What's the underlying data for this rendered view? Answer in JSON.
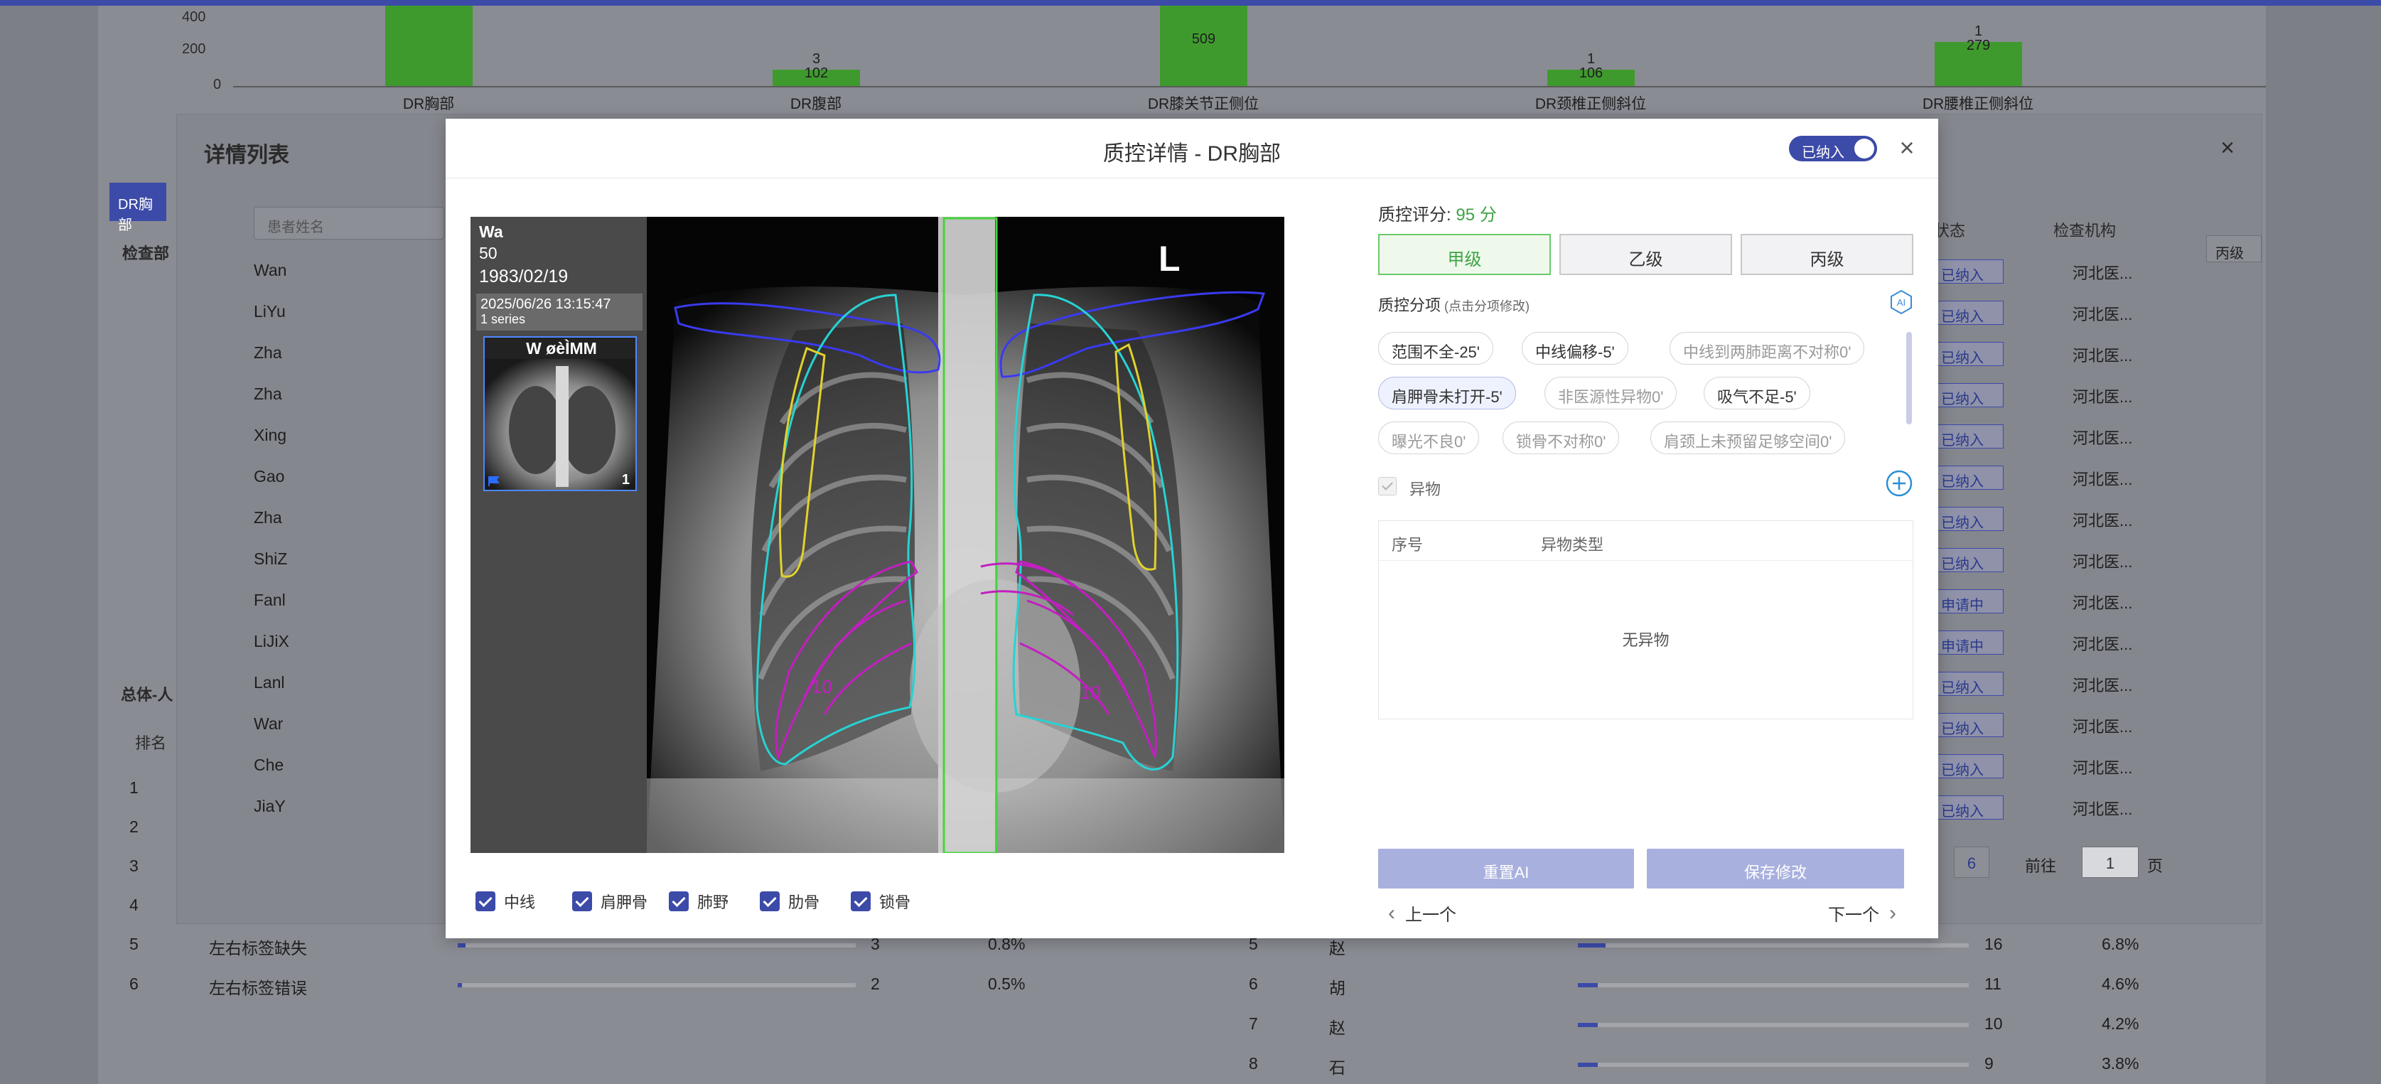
{
  "background": {
    "chart": {
      "y_ticks": [
        "400",
        "200",
        "0"
      ],
      "bars": [
        {
          "category": "DR胸部",
          "value_label": "",
          "top_label": "",
          "fill": 1.0
        },
        {
          "category": "DR腹部",
          "value_label": "102",
          "top_label": "3",
          "fill": 0.2
        },
        {
          "category": "DR膝关节正侧位",
          "value_label": "509",
          "top_label": "",
          "fill": 1.0
        },
        {
          "category": "DR颈椎正侧斜位",
          "value_label": "106",
          "top_label": "1",
          "fill": 0.2
        },
        {
          "category": "DR腰椎正侧斜位",
          "value_label": "279",
          "top_label": "1",
          "fill": 0.55
        }
      ]
    },
    "list": {
      "title": "详情列表",
      "tab": "DR胸部",
      "section_label": "检查部",
      "search_placeholder": "患者姓名",
      "names": [
        "Wan",
        "LiYu",
        "Zha",
        "Zha",
        "Xing",
        "Gao",
        "Zha",
        "ShiZ",
        "Fanl",
        "LiJiX",
        "Lanl",
        "War",
        "Che",
        "JiaY"
      ],
      "col_status": "入状态",
      "col_org": "检查机构",
      "statuses": [
        "已纳入",
        "已纳入",
        "已纳入",
        "已纳入",
        "已纳入",
        "已纳入",
        "已纳入",
        "已纳入",
        "申请中",
        "申请中",
        "已纳入",
        "已纳入",
        "已纳入",
        "已纳入"
      ],
      "org": "河北医...",
      "grade_tag": "丙级",
      "pager_page": "6",
      "pager_goto": "前往",
      "pager_input": "1",
      "pager_unit": "页",
      "close": "×"
    },
    "summary": {
      "title": "总体-人",
      "rank_header": "排名",
      "left_rows": [
        {
          "rank": "1"
        },
        {
          "rank": "2"
        },
        {
          "rank": "3"
        },
        {
          "rank": "4"
        },
        {
          "rank": "5",
          "issue": "左右标签缺失",
          "count": "3",
          "pct": "0.8%",
          "fill": 0.02
        },
        {
          "rank": "6",
          "issue": "左右标签错误",
          "count": "2",
          "pct": "0.5%",
          "fill": 0.01
        }
      ],
      "right_rows": [
        {
          "rank": "5",
          "name": "赵",
          "count": "16",
          "pct": "6.8%",
          "fill": 0.07
        },
        {
          "rank": "6",
          "name": "胡",
          "count": "11",
          "pct": "4.6%",
          "fill": 0.05
        },
        {
          "rank": "7",
          "name": "赵",
          "count": "10",
          "pct": "4.2%",
          "fill": 0.05
        },
        {
          "rank": "8",
          "name": "石",
          "count": "9",
          "pct": "3.8%",
          "fill": 0.05
        }
      ]
    }
  },
  "modal": {
    "title": "质控详情 - DR胸部",
    "toggle_label": "已纳入",
    "toggle_on": true,
    "close": "×",
    "viewer": {
      "patient_name": "Wa",
      "patient_age": "50",
      "patient_dob": "1983/02/19",
      "study_time": "2025/06/26 13:15:47",
      "study_series": "1 series",
      "thumb_label": "W øèÌMM",
      "thumb_count": "1",
      "side_marker": "L",
      "rib_labels": [
        "10",
        "10"
      ]
    },
    "overlays": [
      {
        "label": "中线",
        "checked": true
      },
      {
        "label": "肩胛骨",
        "checked": true
      },
      {
        "label": "肺野",
        "checked": true
      },
      {
        "label": "肋骨",
        "checked": true
      },
      {
        "label": "锁骨",
        "checked": true
      }
    ],
    "score_prefix": "质控评分: ",
    "score_value": "95 分",
    "grades": [
      {
        "label": "甲级",
        "active": true
      },
      {
        "label": "乙级",
        "active": false
      },
      {
        "label": "丙级",
        "active": false
      }
    ],
    "subitem_title": "质控分项",
    "subitem_hint": " (点击分项修改)",
    "ai_icon_label": "AI",
    "tags": [
      {
        "label": "范围不全-25'",
        "state": "normal"
      },
      {
        "label": "中线偏移-5'",
        "state": "normal"
      },
      {
        "label": "中线到两肺距离不对称0'",
        "state": "muted"
      },
      {
        "label": "肩胛骨未打开-5'",
        "state": "selected"
      },
      {
        "label": "非医源性异物0'",
        "state": "muted"
      },
      {
        "label": "吸气不足-5'",
        "state": "normal"
      },
      {
        "label": "曝光不良0'",
        "state": "muted"
      },
      {
        "label": "锁骨不对称0'",
        "state": "muted"
      },
      {
        "label": "肩颈上未预留足够空间0'",
        "state": "muted"
      }
    ],
    "foreign_label": "异物",
    "table_col_index": "序号",
    "table_col_type": "异物类型",
    "table_empty": "无异物",
    "btn_reset": "重置AI",
    "btn_save": "保存修改",
    "nav_prev": "上一个",
    "nav_next": "下一个",
    "colors": {
      "primary": "#3c4aa8",
      "score_green": "#3fa346",
      "midline": "#46d43c",
      "clavicle": "#3a3af0",
      "lung": "#27d3d3",
      "scapula": "#e2d22c",
      "rib": "#c21fc0"
    }
  }
}
